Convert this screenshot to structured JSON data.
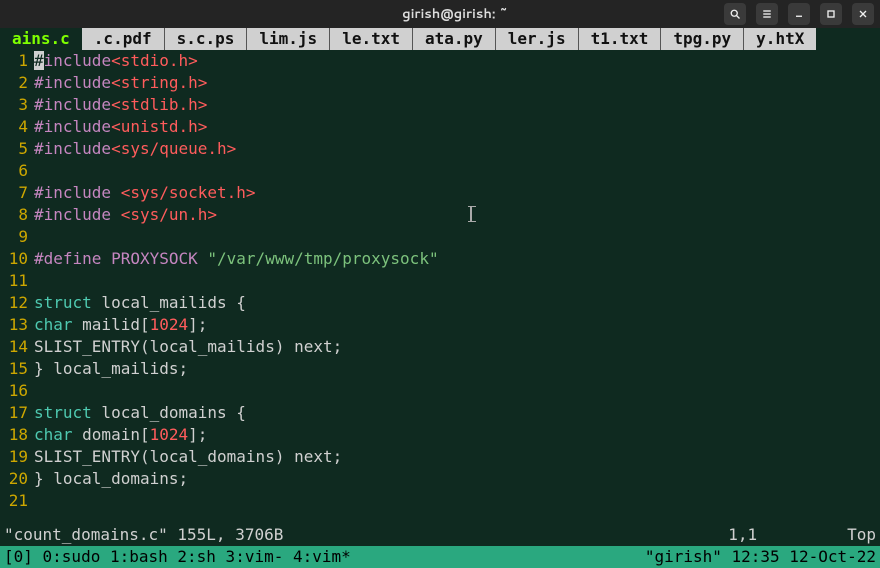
{
  "window": {
    "title": "girish@girish: ~"
  },
  "tabs": {
    "active": "ains.c",
    "inactive": [
      " .c.pdf",
      "s.c.ps",
      "lim.js",
      "le.txt",
      "ata.py",
      "ler.js",
      "t1.txt",
      "tpg.py",
      "y.htX"
    ]
  },
  "lines": [
    {
      "n": "1",
      "tokens": [
        {
          "t": "#",
          "c": "cursor-block"
        },
        {
          "t": "include",
          "c": "tok-pp"
        },
        {
          "t": "<stdio.h>",
          "c": "tok-inc"
        }
      ]
    },
    {
      "n": "2",
      "tokens": [
        {
          "t": "#include",
          "c": "tok-pp"
        },
        {
          "t": "<string.h>",
          "c": "tok-inc"
        }
      ]
    },
    {
      "n": "3",
      "tokens": [
        {
          "t": "#include",
          "c": "tok-pp"
        },
        {
          "t": "<stdlib.h>",
          "c": "tok-inc"
        }
      ]
    },
    {
      "n": "4",
      "tokens": [
        {
          "t": "#include",
          "c": "tok-pp"
        },
        {
          "t": "<unistd.h>",
          "c": "tok-inc"
        }
      ]
    },
    {
      "n": "5",
      "tokens": [
        {
          "t": "#include",
          "c": "tok-pp"
        },
        {
          "t": "<sys/queue.h>",
          "c": "tok-inc"
        }
      ]
    },
    {
      "n": "6",
      "tokens": []
    },
    {
      "n": "7",
      "tokens": [
        {
          "t": "#include ",
          "c": "tok-pp"
        },
        {
          "t": "<sys/socket.h>",
          "c": "tok-inc"
        }
      ]
    },
    {
      "n": "8",
      "tokens": [
        {
          "t": "#include ",
          "c": "tok-pp"
        },
        {
          "t": "<sys/un.h>",
          "c": "tok-inc"
        }
      ]
    },
    {
      "n": "9",
      "tokens": []
    },
    {
      "n": "10",
      "tokens": [
        {
          "t": "#define PROXYSOCK ",
          "c": "tok-pp"
        },
        {
          "t": "\"/var/www/tmp/proxysock\"",
          "c": "tok-str"
        }
      ]
    },
    {
      "n": "11",
      "tokens": []
    },
    {
      "n": "12",
      "tokens": [
        {
          "t": "struct",
          "c": "tok-kw"
        },
        {
          "t": " local_mailids {",
          "c": "tok-plain"
        }
      ]
    },
    {
      "n": "13",
      "tokens": [
        {
          "t": "char",
          "c": "tok-kw"
        },
        {
          "t": " mailid[",
          "c": "tok-plain"
        },
        {
          "t": "1024",
          "c": "tok-num"
        },
        {
          "t": "];",
          "c": "tok-plain"
        }
      ]
    },
    {
      "n": "14",
      "tokens": [
        {
          "t": "SLIST_ENTRY(local_mailids) next;",
          "c": "tok-plain"
        }
      ]
    },
    {
      "n": "15",
      "tokens": [
        {
          "t": "} local_mailids;",
          "c": "tok-plain"
        }
      ]
    },
    {
      "n": "16",
      "tokens": []
    },
    {
      "n": "17",
      "tokens": [
        {
          "t": "struct",
          "c": "tok-kw"
        },
        {
          "t": " local_domains {",
          "c": "tok-plain"
        }
      ]
    },
    {
      "n": "18",
      "tokens": [
        {
          "t": "char",
          "c": "tok-kw"
        },
        {
          "t": " domain[",
          "c": "tok-plain"
        },
        {
          "t": "1024",
          "c": "tok-num"
        },
        {
          "t": "];",
          "c": "tok-plain"
        }
      ]
    },
    {
      "n": "19",
      "tokens": [
        {
          "t": "SLIST_ENTRY(local_domains) next;",
          "c": "tok-plain"
        }
      ]
    },
    {
      "n": "20",
      "tokens": [
        {
          "t": "} local_domains;",
          "c": "tok-plain"
        }
      ]
    },
    {
      "n": "21",
      "tokens": []
    }
  ],
  "status": {
    "file_info": "\"count_domains.c\" 155L, 3706B",
    "pos": "1,1",
    "scroll": "Top"
  },
  "tmux": {
    "left": "[0] 0:sudo  1:bash  2:sh  3:vim- 4:vim*",
    "right": "\"girish\" 12:35 12-Oct-22"
  }
}
